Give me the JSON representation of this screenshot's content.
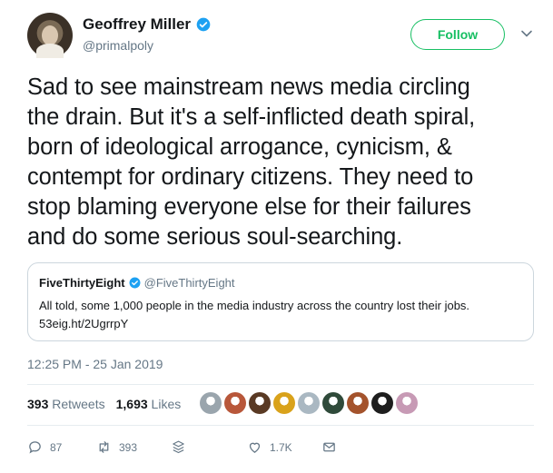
{
  "author": {
    "display_name": "Geoffrey Miller",
    "handle": "@primalpoly"
  },
  "follow_label": "Follow",
  "tweet_lines": [
    "Sad to see mainstream news media circling",
    "the drain. But it's a self-inflicted death spiral,",
    "born of ideological arrogance, cynicism, &",
    "contempt for ordinary citizens. They need to",
    "stop blaming everyone else for their failures",
    "and do some serious soul-searching."
  ],
  "quoted_tweet": {
    "display_name": "FiveThirtyEight",
    "handle": "@FiveThirtyEight",
    "lines": [
      "All told, some 1,000 people in the media industry across the country lost their jobs.",
      "53eig.ht/2UgrrpY"
    ]
  },
  "timestamp": "12:25 PM - 25 Jan 2019",
  "stats": {
    "retweets_count": "393",
    "retweets_label": "Retweets",
    "likes_count": "1,693",
    "likes_label": "Likes"
  },
  "liker_avatar_colors": [
    "#9aa5ad",
    "#b8573a",
    "#5a3a24",
    "#d9a21b",
    "#aab8c2",
    "#2f4a3a",
    "#a4532c",
    "#1e1e1e",
    "#c79ab5"
  ],
  "actions": {
    "reply_count": "87",
    "retweet_count": "393",
    "like_count": "1.7K"
  },
  "colors": {
    "accent_green": "#17bf63",
    "verified_blue": "#1da1f2",
    "muted": "#657786"
  }
}
